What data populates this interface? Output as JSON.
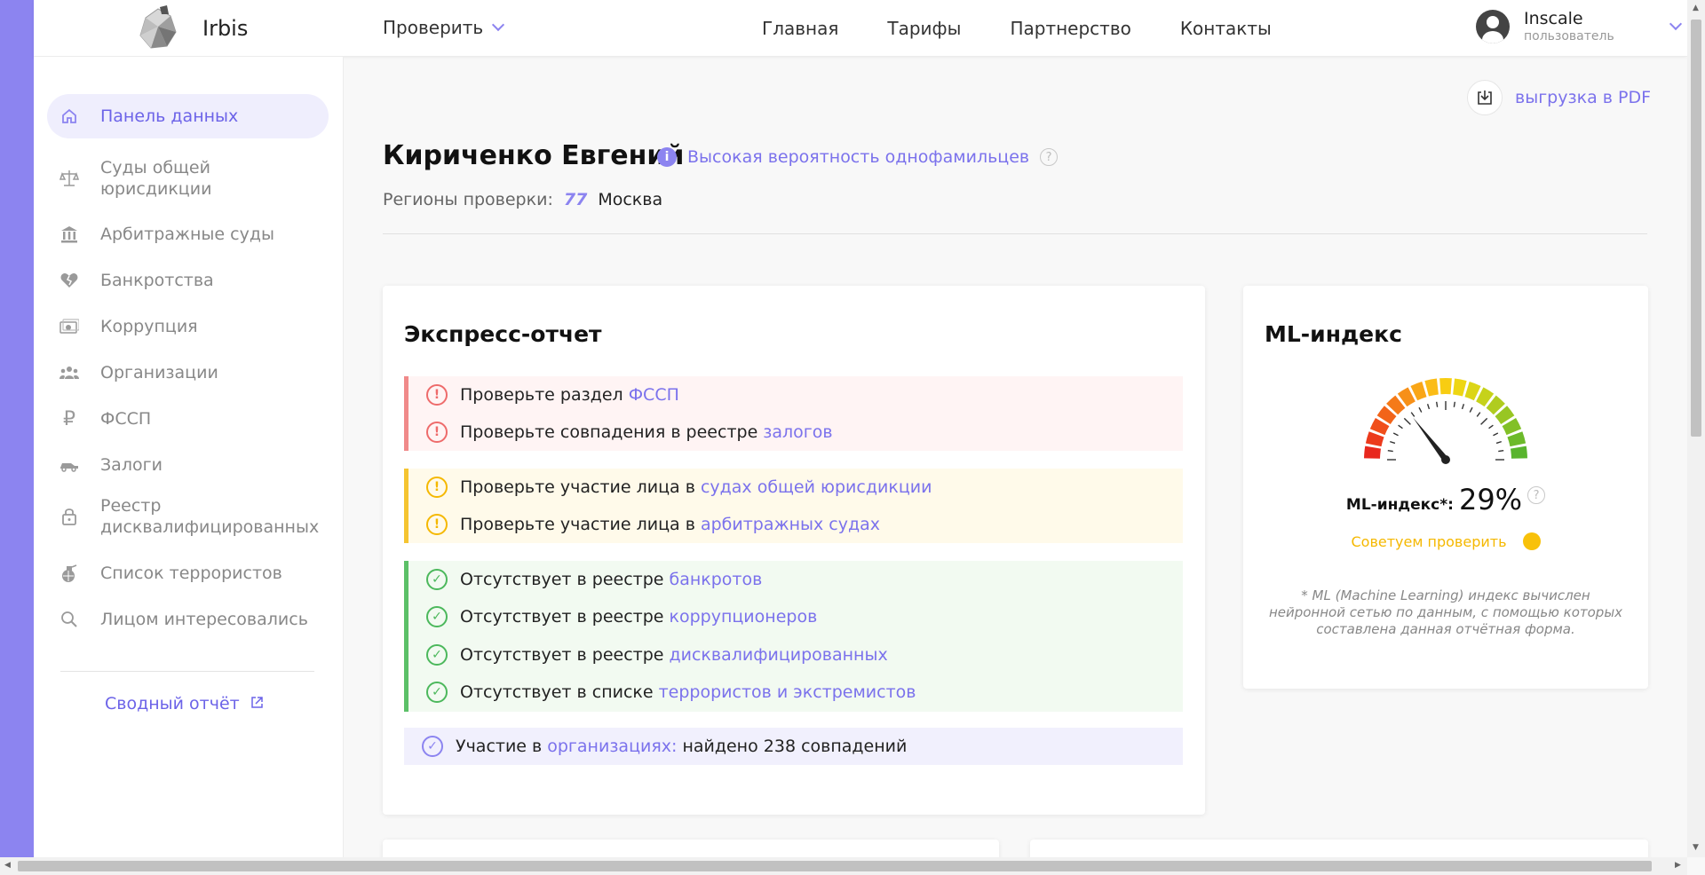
{
  "header": {
    "logo_text": "Irbis",
    "check_menu": "Проверить",
    "nav": [
      "Главная",
      "Тарифы",
      "Партнерство",
      "Контакты"
    ],
    "user_name": "Inscale",
    "user_role": "пользователь"
  },
  "sidebar": {
    "items": [
      {
        "label": "Панель данных",
        "icon": "home-icon"
      },
      {
        "label": "Суды общей юрисдикции",
        "icon": "scales-icon"
      },
      {
        "label": "Арбитражные суды",
        "icon": "courthouse-icon"
      },
      {
        "label": "Банкротства",
        "icon": "heart-broken-icon"
      },
      {
        "label": "Коррупция",
        "icon": "money-icon"
      },
      {
        "label": "Организации",
        "icon": "group-icon"
      },
      {
        "label": "ФССП",
        "icon": "ruble-icon"
      },
      {
        "label": "Залоги",
        "icon": "car-icon"
      },
      {
        "label": "Реестр дисквалифицированных",
        "icon": "lock-icon"
      },
      {
        "label": "Список террористов",
        "icon": "grenade-icon"
      },
      {
        "label": "Лицом интересовались",
        "icon": "search-icon"
      }
    ],
    "summary_label": "Сводный отчёт"
  },
  "main": {
    "pdf_label": "выгрузка в PDF",
    "person_name": "Кириченко Евгений",
    "namesake_label": "Высокая вероятность однофамильцев",
    "regions_label": "Регионы проверки:",
    "region_code": "77",
    "region_city": "Москва"
  },
  "express": {
    "title": "Экспресс-отчет",
    "red": [
      {
        "text": "Проверьте раздел",
        "link": "ФССП"
      },
      {
        "text": "Проверьте совпадения в реестре",
        "link": "залогов"
      }
    ],
    "yellow": [
      {
        "text": "Проверьте участие лица в",
        "link": "судах общей юрисдикции"
      },
      {
        "text": "Проверьте участие лица в",
        "link": "арбитражных судах"
      }
    ],
    "green": [
      {
        "text": "Отсутствует в реестре",
        "link": "банкротов"
      },
      {
        "text": "Отсутствует в реестре",
        "link": "коррупционеров"
      },
      {
        "text": "Отсутствует в реестре",
        "link": "дисквалифицированных"
      },
      {
        "text": "Отсутствует в списке",
        "link": "террористов и экстремистов"
      }
    ],
    "violet": {
      "text": "Участие в",
      "link": "организациях:",
      "after": "найдено 238 совпадений"
    }
  },
  "ml": {
    "title": "ML-индекс",
    "label": "ML-индекс*:",
    "value": "29%",
    "value_fraction": 0.29,
    "advice": "Советуем проверить",
    "note": "* ML (Machine Learning) индекс вычислен нейронной сетью по данным, с помощью которых составлена данная отчётная форма."
  },
  "colors": {
    "accent": "#8c84f0",
    "red": "#ee6b6b",
    "yellow": "#f5b800",
    "green": "#4cb85c"
  }
}
